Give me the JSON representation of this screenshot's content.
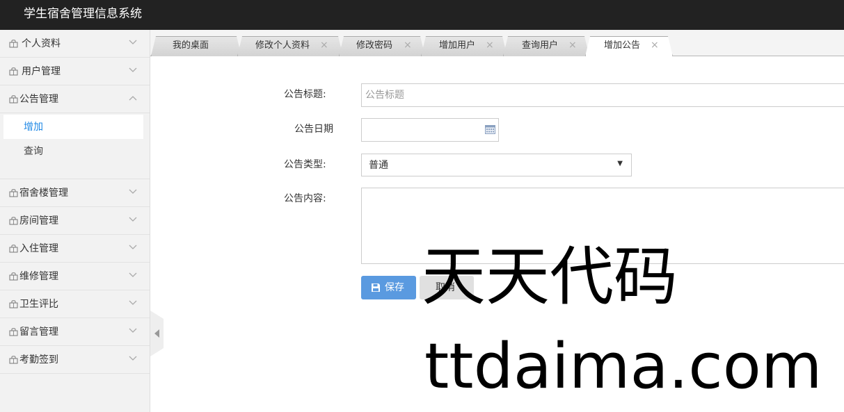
{
  "app": {
    "title": "学生宿舍管理信息系统"
  },
  "sidebar": {
    "items": [
      {
        "label": "个人资料",
        "expanded": false
      },
      {
        "label": "用户管理",
        "expanded": false
      },
      {
        "label": "公告管理",
        "expanded": true,
        "children": [
          "增加",
          "查询"
        ]
      },
      {
        "label": "宿舍楼管理",
        "expanded": false
      },
      {
        "label": "房间管理",
        "expanded": false
      },
      {
        "label": "入住管理",
        "expanded": false
      },
      {
        "label": "维修管理",
        "expanded": false
      },
      {
        "label": "卫生评比",
        "expanded": false
      },
      {
        "label": "留言管理",
        "expanded": false
      },
      {
        "label": "考勤签到",
        "expanded": false
      }
    ]
  },
  "tabs": [
    {
      "label": "我的桌面",
      "closable": false,
      "active": false
    },
    {
      "label": "修改个人资料",
      "closable": true,
      "active": false
    },
    {
      "label": "修改密码",
      "closable": true,
      "active": false
    },
    {
      "label": "增加用户",
      "closable": true,
      "active": false
    },
    {
      "label": "查询用户",
      "closable": true,
      "active": false
    },
    {
      "label": "增加公告",
      "closable": true,
      "active": true
    }
  ],
  "tab_close_symbol": "×",
  "form": {
    "title_label": "公告标题:",
    "title_placeholder": "公告标题",
    "date_label": "公告日期",
    "type_label": "公告类型:",
    "type_value": "普通",
    "type_arrow": "▼",
    "content_label": "公告内容:",
    "save_label": "保存",
    "cancel_label": "取消"
  },
  "icons": {
    "menu": "bag-icon",
    "chevron": "chevron-icon",
    "calendar": "calendar-icon",
    "save": "floppy-icon",
    "collapse": "triangle-left-icon"
  },
  "colors": {
    "topbar": "#222222",
    "accent": "#1e88e5",
    "save_button": "#5a9ae0"
  },
  "watermark": {
    "cn": "天天代码",
    "en": "ttdaima.com"
  }
}
